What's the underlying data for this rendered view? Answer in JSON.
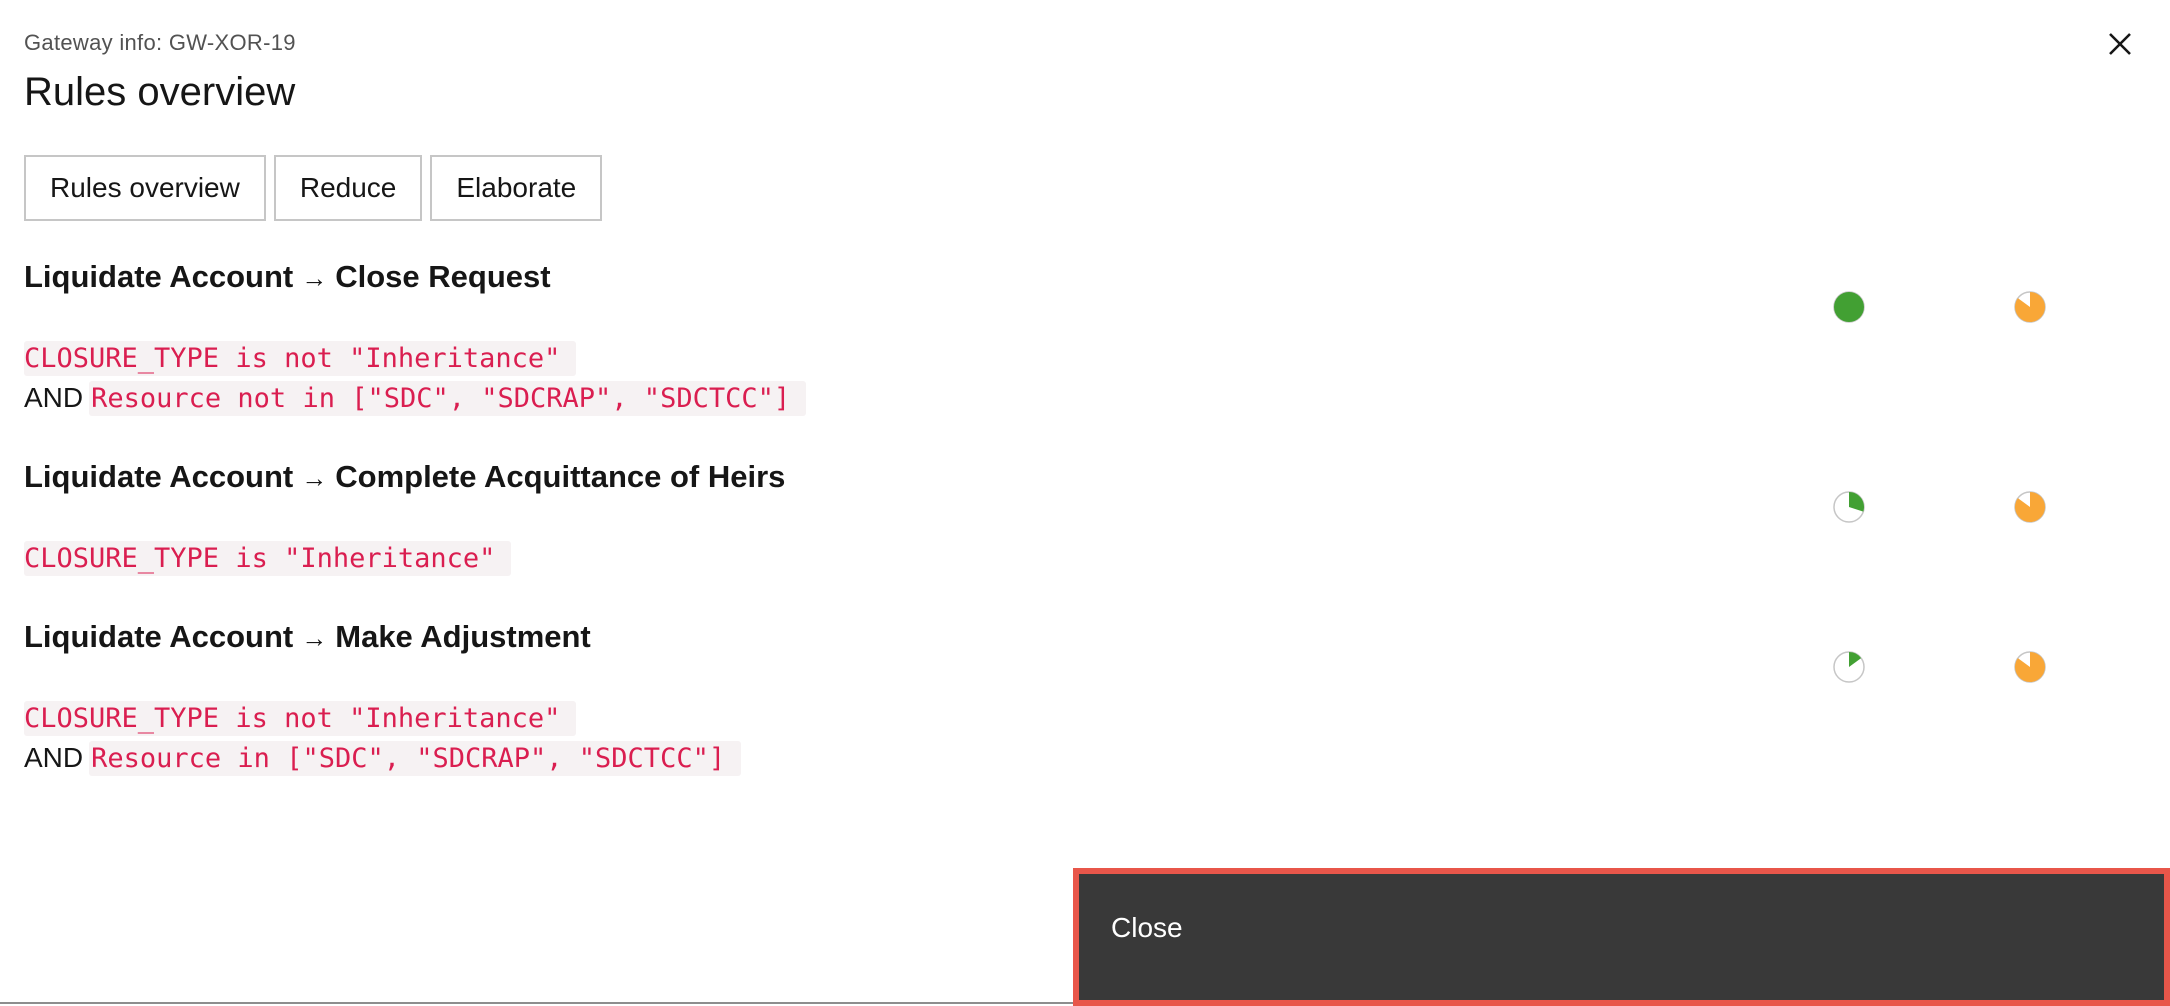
{
  "header": {
    "label": "Gateway info: GW-XOR-19",
    "title": "Rules overview"
  },
  "tabs": [
    {
      "label": "Rules overview"
    },
    {
      "label": "Reduce"
    },
    {
      "label": "Elaborate"
    }
  ],
  "rules": [
    {
      "source": "Liquidate Account",
      "arrow": "→",
      "target": "Close Request",
      "conditions": [
        {
          "prefix": "",
          "code": "CLOSURE_TYPE is not \"Inheritance\""
        },
        {
          "prefix": "AND",
          "code": "Resource not in [\"SDC\", \"SDCRAP\", \"SDCTCC\"]"
        }
      ],
      "indicator_green_fraction": 1.0,
      "indicator_orange_fraction": 0.85
    },
    {
      "source": "Liquidate Account",
      "arrow": "→",
      "target": "Complete Acquittance of Heirs",
      "conditions": [
        {
          "prefix": "",
          "code": "CLOSURE_TYPE is \"Inheritance\""
        }
      ],
      "indicator_green_fraction": 0.3,
      "indicator_orange_fraction": 0.85
    },
    {
      "source": "Liquidate Account",
      "arrow": "→",
      "target": "Make Adjustment",
      "conditions": [
        {
          "prefix": "",
          "code": "CLOSURE_TYPE is not \"Inheritance\""
        },
        {
          "prefix": "AND",
          "code": "Resource in [\"SDC\", \"SDCRAP\", \"SDCTCC\"]"
        }
      ],
      "indicator_green_fraction": 0.15,
      "indicator_orange_fraction": 0.85
    }
  ],
  "footer": {
    "close_label": "Close"
  },
  "colors": {
    "green": "#42a033",
    "orange": "#f9a737",
    "code_red": "#da1e50",
    "footer_bg": "#393939",
    "footer_border": "#e8564a"
  }
}
